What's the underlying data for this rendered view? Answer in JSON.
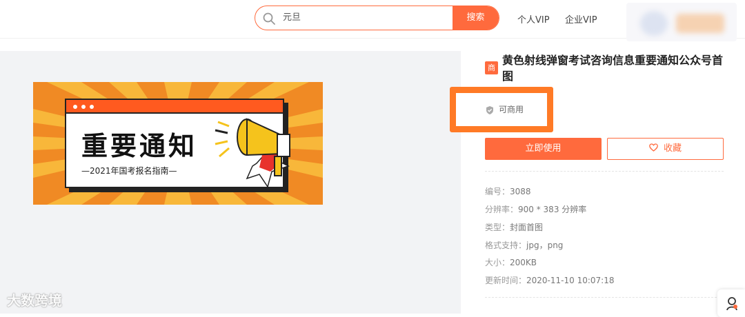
{
  "header": {
    "search_value": "元旦",
    "search_button": "搜索",
    "nav": [
      "个人VIP",
      "企业VIP"
    ]
  },
  "poster": {
    "headline": "重要通知",
    "subline": "—2021年国考报名指南—"
  },
  "watermark": "大数跨境",
  "detail": {
    "badge": "商",
    "title": "黄色射线弹窗考试咨询信息重要通知公众号首图",
    "commercial_label": "可商用",
    "use_button": "立即使用",
    "favorite_button": "收藏",
    "info": [
      {
        "key": "编号：",
        "value": "3088"
      },
      {
        "key": "分辨率：",
        "value": "900 * 383 分辨率"
      },
      {
        "key": "类型：",
        "value": "封面首图"
      },
      {
        "key": "格式支持：",
        "value": "jpg，png"
      },
      {
        "key": "大小：",
        "value": "200KB"
      },
      {
        "key": "更新时间：",
        "value": "2020-11-10 10:07:18"
      }
    ]
  },
  "colors": {
    "accent": "#ff6a3d",
    "highlight_border": "#ff7a26",
    "poster_bg": "#f5a623"
  }
}
